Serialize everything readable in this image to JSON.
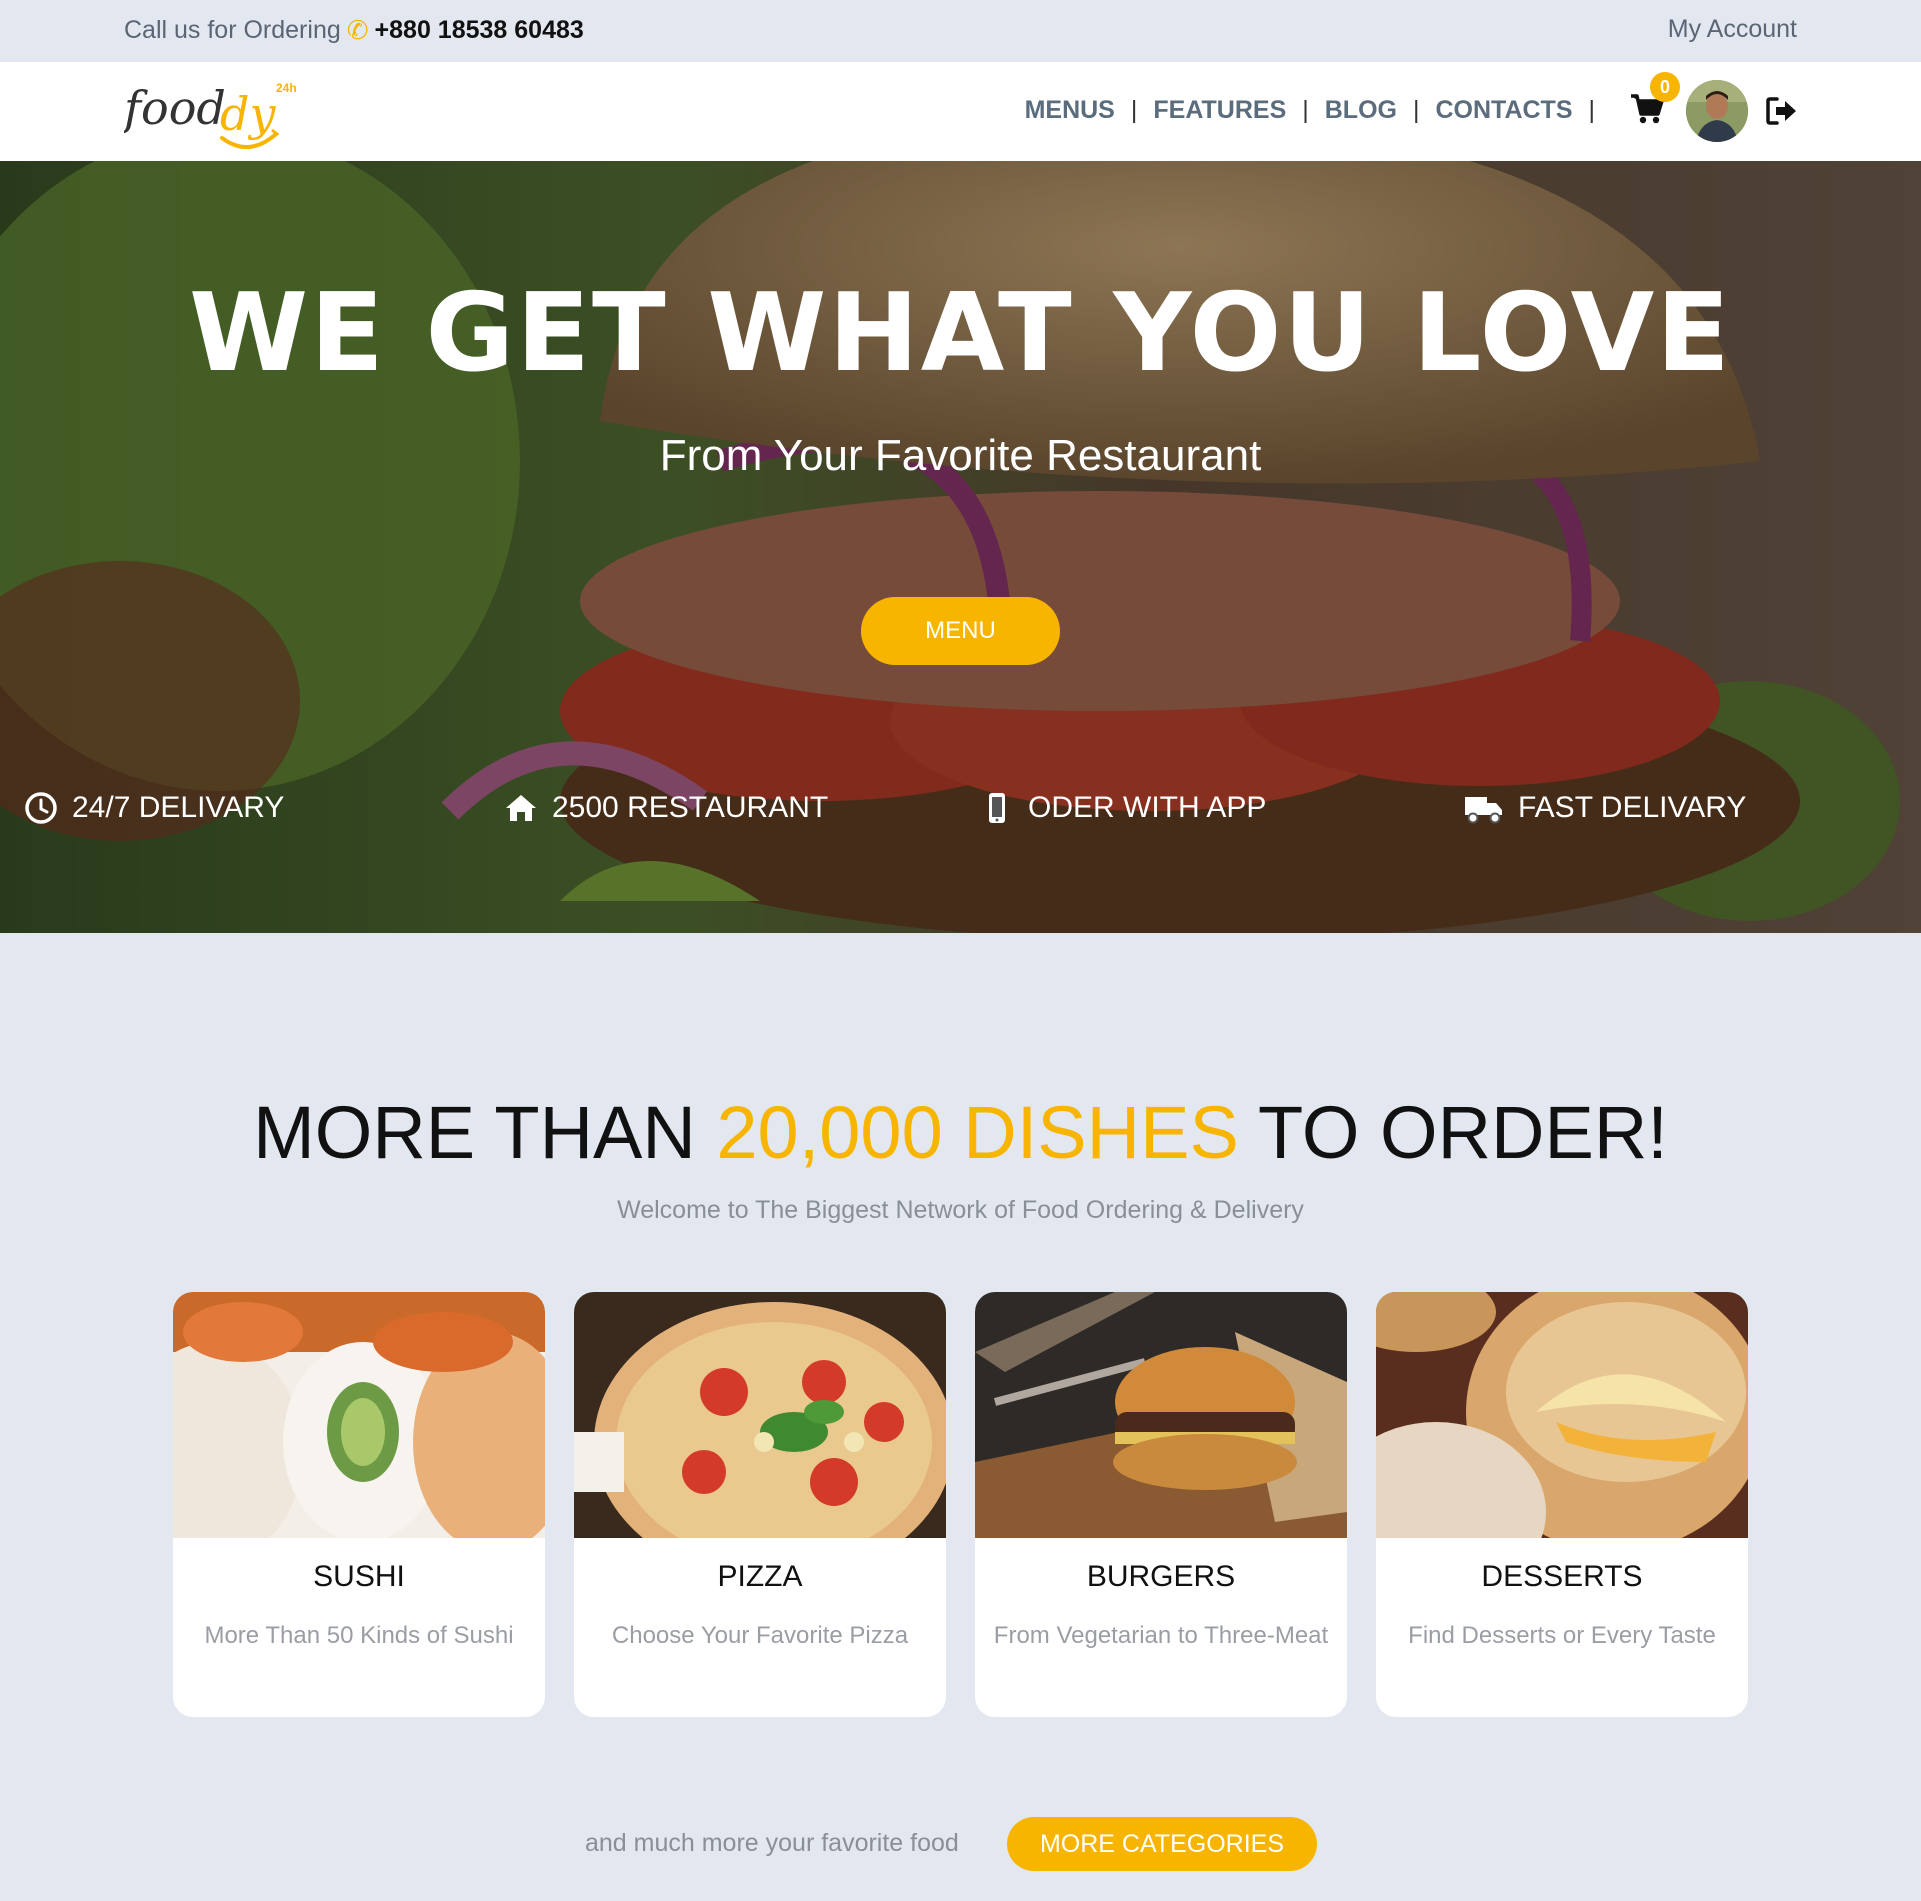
{
  "topbar": {
    "call_label": "Call us for Ordering",
    "phone": "+880 18538 60483",
    "account_label": "My Account"
  },
  "nav": {
    "logo_text": "fooddy",
    "logo_badge": "24h",
    "links": [
      "MENUS",
      "FEATURES",
      "BLOG",
      "CONTACTS"
    ],
    "separator": "|",
    "cart_count": "0",
    "icons": [
      "cart-icon",
      "avatar",
      "logout-icon"
    ]
  },
  "hero": {
    "title": "WE GET WHAT YOU LOVE",
    "subtitle": "From Your Favorite Restaurant",
    "button_label": "MENU",
    "features": [
      {
        "icon": "clock-icon",
        "label": "24/7 DELIVARY"
      },
      {
        "icon": "home-icon",
        "label": "2500 RESTAURANT"
      },
      {
        "icon": "mobile-icon",
        "label": "ODER WITH APP"
      },
      {
        "icon": "truck-icon",
        "label": "FAST DELIVARY"
      }
    ]
  },
  "dishes": {
    "title_part1": "MORE THAN ",
    "title_accent": "20,000 DISHES",
    "title_part2": " TO ORDER!",
    "subtitle": "Welcome to The Biggest Network of Food Ordering & Delivery",
    "cards": [
      {
        "name": "SUSHI",
        "desc": "More Than 50 Kinds of Sushi"
      },
      {
        "name": "PIZZA",
        "desc": "Choose Your Favorite Pizza"
      },
      {
        "name": "BURGERS",
        "desc": "From Vegetarian to Three-Meat"
      },
      {
        "name": "DESSERTS",
        "desc": "Find Desserts or Every Taste"
      }
    ],
    "more_text": "and much more your favorite food",
    "more_button": "MORE CATEGORIES"
  },
  "colors": {
    "accent": "#f7b500",
    "background": "#e3e8f0",
    "nav_text": "#5b6c7d"
  }
}
